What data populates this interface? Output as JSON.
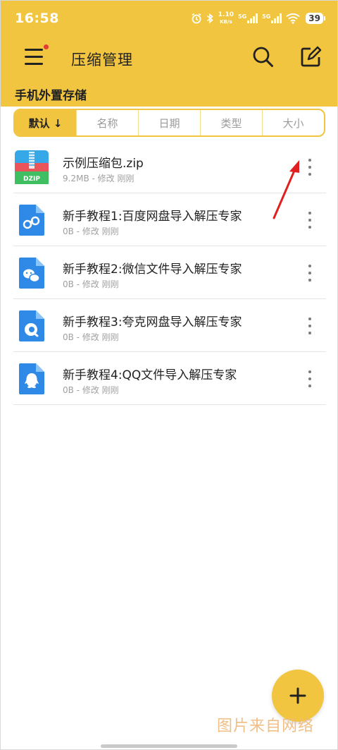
{
  "status_bar": {
    "time": "16:58",
    "speed_value": "1.10",
    "speed_unit": "KB/s",
    "network_1": "5G",
    "network_2": "5G",
    "battery": "39"
  },
  "toolbar": {
    "title": "压缩管理",
    "menu_icon": "menu-icon",
    "search_icon": "search-icon",
    "edit_icon": "edit-icon"
  },
  "storage_label": "手机外置存储",
  "sort_tabs": [
    {
      "label": "默认 ↓",
      "active": true
    },
    {
      "label": "名称",
      "active": false
    },
    {
      "label": "日期",
      "active": false
    },
    {
      "label": "类型",
      "active": false
    },
    {
      "label": "大小",
      "active": false
    }
  ],
  "files": [
    {
      "name": "示例压缩包.zip",
      "meta": "9.2MB - 修改 刚刚",
      "icon": "zip-icon",
      "icon_text": "DZIP"
    },
    {
      "name": "新手教程1:百度网盘导入解压专家",
      "meta": "0B - 修改 刚刚",
      "icon": "baidu-netdisk-icon"
    },
    {
      "name": "新手教程2:微信文件导入解压专家",
      "meta": "0B - 修改 刚刚",
      "icon": "wechat-icon"
    },
    {
      "name": "新手教程3:夸克网盘导入解压专家",
      "meta": "0B - 修改 刚刚",
      "icon": "quark-icon"
    },
    {
      "name": "新手教程4:QQ文件导入解压专家",
      "meta": "0B - 修改 刚刚",
      "icon": "qq-icon"
    }
  ],
  "fab": {
    "icon": "plus-icon",
    "label": "+"
  },
  "watermark": "图片来自网络",
  "colors": {
    "accent": "#f1c540",
    "doc_blue": "#2e8ae6",
    "annotation_red": "#e02020"
  }
}
